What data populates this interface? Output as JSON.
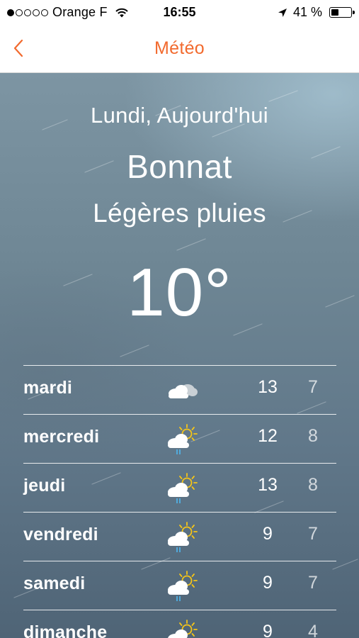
{
  "status_bar": {
    "carrier": "Orange F",
    "time": "16:55",
    "battery": "41 %",
    "battery_level": 0.41,
    "signal_strength": 1,
    "icons": [
      "signal-dots-icon",
      "wifi-icon",
      "location-arrow-icon",
      "battery-icon"
    ]
  },
  "nav": {
    "title": "Météo",
    "back_icon": "chevron-left-icon",
    "accent_color": "#f26a2e"
  },
  "current": {
    "date": "Lundi, Aujourd'hui",
    "city": "Bonnat",
    "condition": "Légères pluies",
    "temperature": "10°"
  },
  "forecast": [
    {
      "day": "mardi",
      "icon": "cloudy-icon",
      "max": "13",
      "min": "7"
    },
    {
      "day": "mercredi",
      "icon": "sun-cloud-rain-icon",
      "max": "12",
      "min": "8"
    },
    {
      "day": "jeudi",
      "icon": "sun-cloud-rain-icon",
      "max": "13",
      "min": "8"
    },
    {
      "day": "vendredi",
      "icon": "sun-cloud-rain-icon",
      "max": "9",
      "min": "7"
    },
    {
      "day": "samedi",
      "icon": "sun-cloud-rain-icon",
      "max": "9",
      "min": "7"
    },
    {
      "day": "dimanche",
      "icon": "sun-cloud-rain-icon",
      "max": "9",
      "min": "4"
    }
  ]
}
